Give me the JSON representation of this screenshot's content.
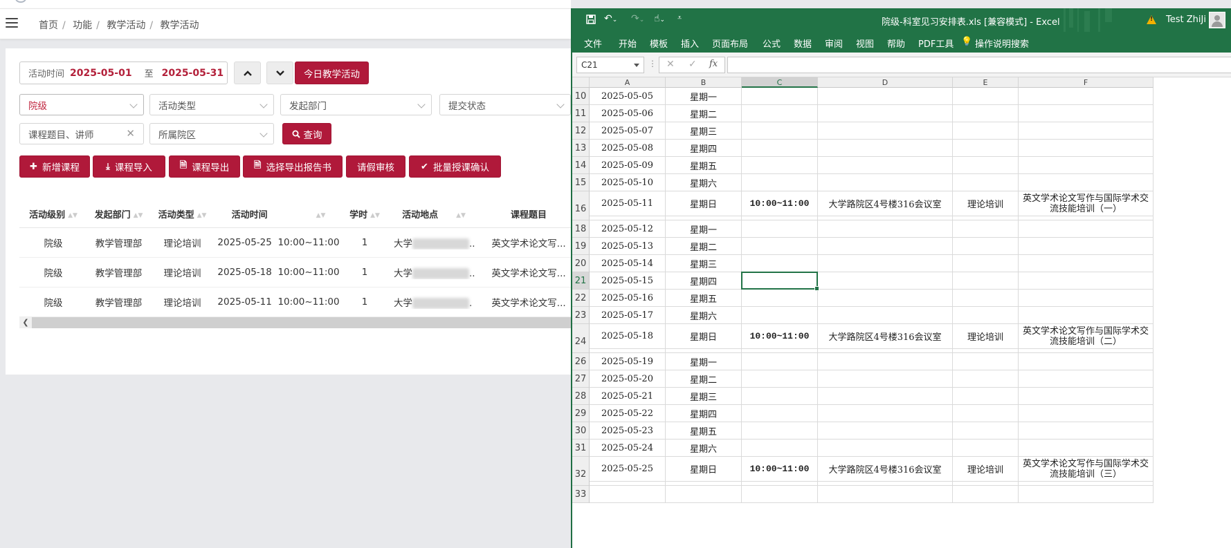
{
  "web": {
    "breadcrumb": [
      "首页",
      "功能",
      "教学活动",
      "教学活动"
    ],
    "filter": {
      "date_label": "活动时间",
      "date_from": "2025-05-01",
      "date_to_sep": "至",
      "date_to": "2025-05-31",
      "today_button": "今日教学活动",
      "level_select": "院级",
      "activity_type_placeholder": "活动类型",
      "dept_placeholder": "发起部门",
      "status_placeholder": "提交状态",
      "keyword_placeholder": "课程题目、讲师",
      "campus_placeholder": "所属院区",
      "query_button": "查询"
    },
    "actions": {
      "add": "新增课程",
      "import": "课程导入",
      "export": "课程导出",
      "export_report": "选择导出报告书",
      "leave_review": "请假审核",
      "batch_confirm": "批量授课确认"
    },
    "table": {
      "headers": [
        "活动级别",
        "发起部门",
        "活动类型",
        "活动时间",
        "学时",
        "活动地点",
        "课程题目"
      ],
      "rows": [
        [
          "院级",
          "教学管理部",
          "理论培训",
          "2025-05-25  10:00~11:00",
          "1",
          "大学",
          "英文学术论文写..."
        ],
        [
          "院级",
          "教学管理部",
          "理论培训",
          "2025-05-18  10:00~11:00",
          "1",
          "大学",
          "英文学术论文写..."
        ],
        [
          "院级",
          "教学管理部",
          "理论培训",
          "2025-05-11  10:00~11:00",
          "1",
          "大学",
          "英文学术论文写..."
        ]
      ]
    }
  },
  "excel": {
    "title": "院级-科室见习安排表.xls  [兼容模式]  -  Excel",
    "user": "Test ZhiJi",
    "ribbon_tabs": [
      "文件",
      "开始",
      "模板",
      "插入",
      "页面布局",
      "公式",
      "数据",
      "审阅",
      "视图",
      "帮助",
      "PDF工具",
      "操作说明搜索"
    ],
    "name_box": "C21",
    "fx": "fx",
    "columns": [
      "A",
      "B",
      "C",
      "D",
      "E",
      "F"
    ],
    "rows": [
      {
        "n": "10",
        "a": "2025-05-05",
        "b": "星期一"
      },
      {
        "n": "11",
        "a": "2025-05-06",
        "b": "星期二"
      },
      {
        "n": "12",
        "a": "2025-05-07",
        "b": "星期三"
      },
      {
        "n": "13",
        "a": "2025-05-08",
        "b": "星期四"
      },
      {
        "n": "14",
        "a": "2025-05-09",
        "b": "星期五"
      },
      {
        "n": "15",
        "a": "2025-05-10",
        "b": "星期六"
      },
      {
        "n": "16",
        "a": "2025-05-11",
        "b": "星期日",
        "c": "10:00~11:00",
        "d": "大学路院区4号楼316会议室",
        "e": "理论培训",
        "f": "英文学术论文写作与国际学术交流技能培训（一）"
      },
      {
        "n": "18",
        "a": "2025-05-12",
        "b": "星期一"
      },
      {
        "n": "19",
        "a": "2025-05-13",
        "b": "星期二"
      },
      {
        "n": "20",
        "a": "2025-05-14",
        "b": "星期三"
      },
      {
        "n": "21",
        "a": "2025-05-15",
        "b": "星期四"
      },
      {
        "n": "22",
        "a": "2025-05-16",
        "b": "星期五"
      },
      {
        "n": "23",
        "a": "2025-05-17",
        "b": "星期六"
      },
      {
        "n": "24",
        "a": "2025-05-18",
        "b": "星期日",
        "c": "10:00~11:00",
        "d": "大学路院区4号楼316会议室",
        "e": "理论培训",
        "f": "英文学术论文写作与国际学术交流技能培训（二）"
      },
      {
        "n": "26",
        "a": "2025-05-19",
        "b": "星期一"
      },
      {
        "n": "27",
        "a": "2025-05-20",
        "b": "星期二"
      },
      {
        "n": "28",
        "a": "2025-05-21",
        "b": "星期三"
      },
      {
        "n": "29",
        "a": "2025-05-22",
        "b": "星期四"
      },
      {
        "n": "30",
        "a": "2025-05-23",
        "b": "星期五"
      },
      {
        "n": "31",
        "a": "2025-05-24",
        "b": "星期六"
      },
      {
        "n": "32",
        "a": "2025-05-25",
        "b": "星期日",
        "c": "10:00~11:00",
        "d": "大学路院区4号楼316会议室",
        "e": "理论培训",
        "f": "英文学术论文写作与国际学术交流技能培训（三）"
      },
      {
        "n": "33"
      }
    ],
    "selected_row": "21",
    "selected_col": "C"
  },
  "colors": {
    "brand_red": "#b0193a",
    "excel_green": "#217346"
  }
}
